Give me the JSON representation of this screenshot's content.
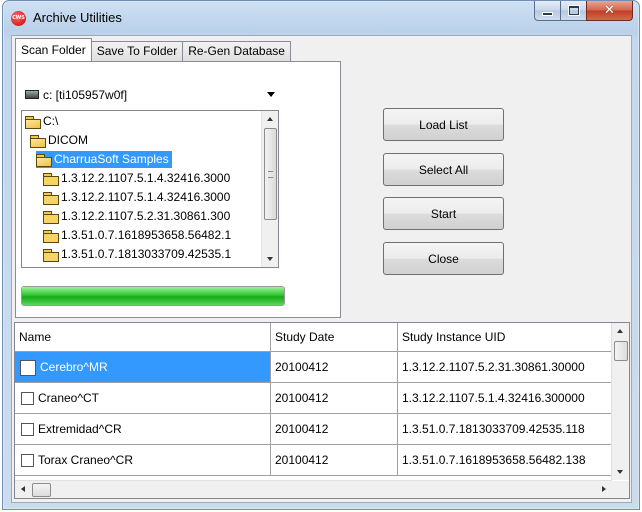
{
  "window": {
    "title": "Archive Utilities",
    "app_icon_text": "CWS",
    "controls": {
      "minimize": "minimize",
      "maximize": "maximize",
      "close": "✕"
    }
  },
  "tabs": [
    {
      "label": "Scan Folder",
      "active": true
    },
    {
      "label": "Save To Folder",
      "active": false
    },
    {
      "label": "Re-Gen Database",
      "active": false
    }
  ],
  "drive_select": {
    "value": "c: [ti105957w0f]"
  },
  "folder_tree": {
    "items": [
      {
        "label": "C:\\",
        "level": 0,
        "open": true,
        "selected": false
      },
      {
        "label": "DICOM",
        "level": 1,
        "open": true,
        "selected": false
      },
      {
        "label": "CharruaSoft Samples",
        "level": 2,
        "open": true,
        "selected": true
      },
      {
        "label": "1.3.12.2.1107.5.1.4.32416.3000",
        "level": 3,
        "open": false,
        "selected": false
      },
      {
        "label": "1.3.12.2.1107.5.1.4.32416.3000",
        "level": 3,
        "open": false,
        "selected": false
      },
      {
        "label": "1.3.12.2.1107.5.2.31.30861.300",
        "level": 3,
        "open": false,
        "selected": false
      },
      {
        "label": "1.3.51.0.7.1618953658.56482.1",
        "level": 3,
        "open": false,
        "selected": false
      },
      {
        "label": "1.3.51.0.7.1813033709.42535.1",
        "level": 3,
        "open": false,
        "selected": false
      }
    ]
  },
  "progress": {
    "fraction": 1.0,
    "color": "#2ec72e"
  },
  "buttons": {
    "load_list": "Load List",
    "select_all": "Select All",
    "start": "Start",
    "close": "Close"
  },
  "study_table": {
    "columns": [
      "Name",
      "Study Date",
      "Study Instance UID"
    ],
    "rows": [
      {
        "name": "Cerebro^MR",
        "date": "20100412",
        "uid": "1.3.12.2.1107.5.2.31.30861.30000",
        "selected": true
      },
      {
        "name": "Craneo^CT",
        "date": "20100412",
        "uid": "1.3.12.2.1107.5.1.4.32416.300000",
        "selected": false
      },
      {
        "name": "Extremidad^CR",
        "date": "20100412",
        "uid": "1.3.51.0.7.1813033709.42535.118",
        "selected": false
      },
      {
        "name": "Torax Craneo^CR",
        "date": "20100412",
        "uid": "1.3.51.0.7.1618953658.56482.138",
        "selected": false
      }
    ]
  },
  "colors": {
    "selection": "#3399ff",
    "title_bar": "#c4d7ee",
    "close_button": "#c13d22"
  }
}
